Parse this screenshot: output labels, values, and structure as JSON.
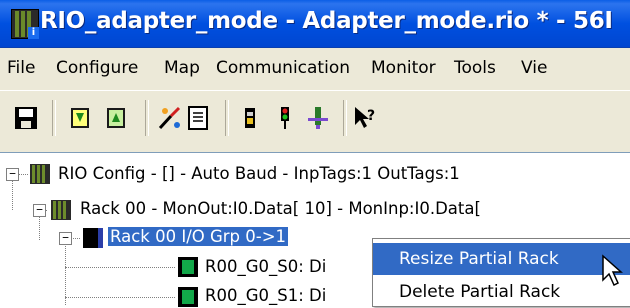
{
  "window": {
    "title": "RIO_adapter_mode - Adapter_mode.rio * - 56I"
  },
  "menu": [
    "File",
    "Configure",
    "Map",
    "Communication",
    "Monitor",
    "Tools",
    "Vie"
  ],
  "toolbar": [
    "save-icon",
    "download-icon",
    "upload-icon",
    "tools-icon",
    "document-icon",
    "module-icon",
    "status-icon",
    "network-icon",
    "help-icon"
  ],
  "tree": {
    "root": "RIO Config - [] - Auto Baud - InpTags:1 OutTags:1",
    "rack": "Rack 00 - MonOut:I0.Data[ 10] - MonInp:I0.Data[",
    "group": "Rack 00 I/O Grp 0->1",
    "slot0": "R00_G0_S0: Di",
    "slot1": "R00_G0_S1: Di"
  },
  "context_menu": {
    "resize": "Resize Partial Rack",
    "delete": "Delete Partial Rack"
  }
}
